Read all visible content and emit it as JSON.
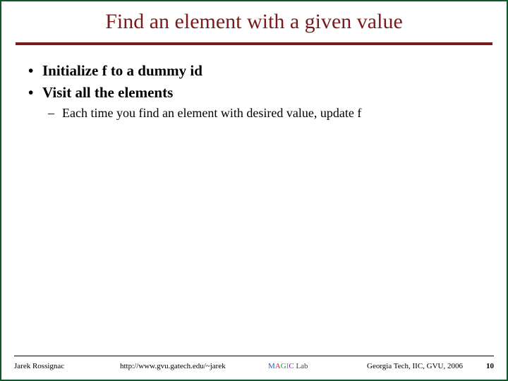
{
  "slide": {
    "title": "Find an element with a given value",
    "bullets": {
      "b1a": "Initialize f to a dummy id",
      "b1b": "Visit all the elements",
      "b2a": "Each time you find an element with desired value, update f"
    }
  },
  "footer": {
    "author": "Jarek Rossignac",
    "url": "http://www.gvu.gatech.edu/~jarek",
    "lab": {
      "m": "M",
      "a": "A",
      "g": "G",
      "i": "I",
      "c": "C",
      "lab": " Lab"
    },
    "org": "Georgia Tech, IIC, GVU, 2006",
    "page": "10"
  }
}
